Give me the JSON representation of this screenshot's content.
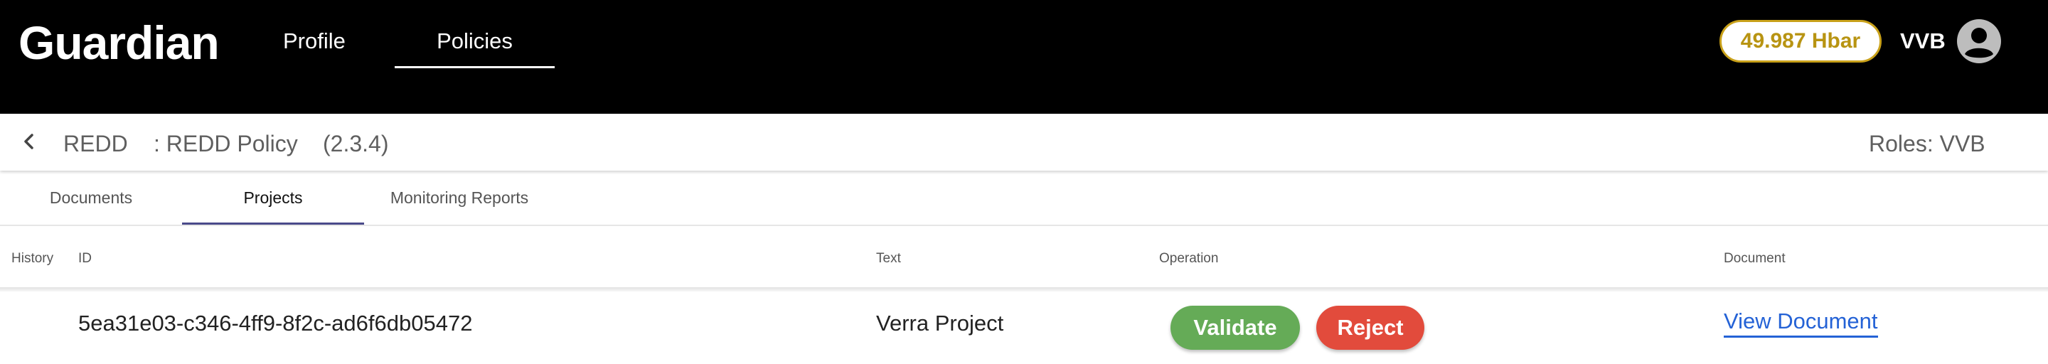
{
  "header": {
    "brand": "Guardian",
    "nav": [
      {
        "label": "Profile",
        "active": false
      },
      {
        "label": "Policies",
        "active": true
      }
    ],
    "balance": "49.987 Hbar",
    "user": "VVB",
    "avatar_icon": "account-circle-icon",
    "colors": {
      "background": "#000000",
      "balance_accent": "#c9a11a"
    }
  },
  "policy_bar": {
    "back_icon": "chevron-left-icon",
    "name": "REDD",
    "policy": ": REDD Policy",
    "version": "(2.3.4)",
    "roles": "Roles: VVB"
  },
  "tabs": [
    {
      "label": "Documents",
      "active": false
    },
    {
      "label": "Projects",
      "active": true
    },
    {
      "label": "Monitoring Reports",
      "active": false
    }
  ],
  "table": {
    "columns": [
      "History",
      "ID",
      "Text",
      "Operation",
      "Document"
    ],
    "rows": [
      {
        "id": "5ea31e03-c346-4ff9-8f2c-ad6f6db05472",
        "text": "Verra Project",
        "operations": [
          "Validate",
          "Reject"
        ],
        "document_link": "View Document"
      }
    ]
  },
  "colors": {
    "validate": "#65ab57",
    "reject": "#e24b3c",
    "link": "#2462d6"
  }
}
